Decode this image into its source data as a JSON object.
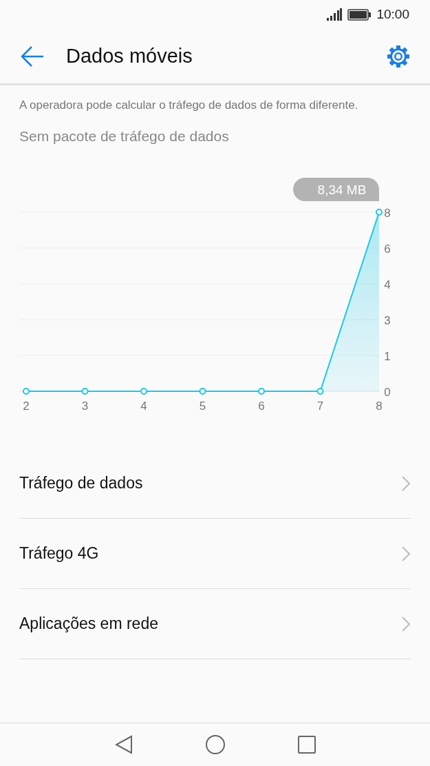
{
  "status_bar": {
    "time": "10:00"
  },
  "header": {
    "title": "Dados móveis"
  },
  "notice": "A operadora pode calcular o tráfego de dados de forma diferente.",
  "plan": "Sem pacote de tráfego de dados",
  "usage_chart": {
    "tooltip": "8,34 MB",
    "x_labels": [
      "2",
      "3",
      "4",
      "5",
      "6",
      "7",
      "8"
    ],
    "y_labels": [
      "8",
      "6",
      "4",
      "3",
      "1",
      "0"
    ]
  },
  "menu": [
    {
      "label": "Tráfego de dados"
    },
    {
      "label": "Tráfego 4G"
    },
    {
      "label": "Aplicações em rede"
    }
  ]
}
